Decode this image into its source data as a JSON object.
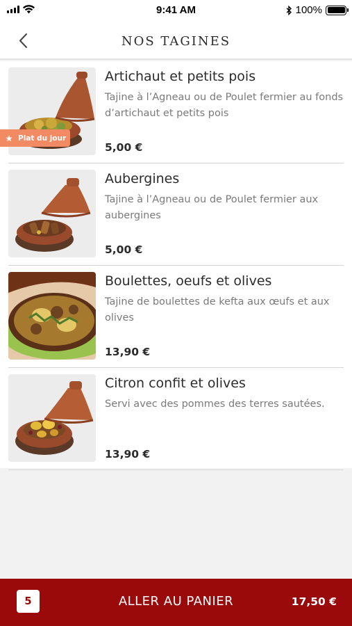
{
  "status_bar": {
    "time": "9:41 AM",
    "battery": "100%",
    "icons": [
      "signal-icon",
      "wifi-icon",
      "bluetooth-icon",
      "battery-icon"
    ]
  },
  "header": {
    "title": "NOS TAGINES",
    "back_icon": "chevron-left-icon"
  },
  "items": [
    {
      "name": "Artichaut et petits pois",
      "description": "Tajine à l’Agneau ou de Poulet fermier au fonds d’artichaut et petits pois",
      "price": "5,00 €",
      "badge": "Plat du jour",
      "badge_icon": "star-icon"
    },
    {
      "name": "Aubergines",
      "description": "Tajine à l’Agneau ou de Poulet fermier aux aubergines",
      "price": "5,00 €"
    },
    {
      "name": "Boulettes, oeufs et olives",
      "description": "Tajine de boulettes de kefta aux œufs et aux olives",
      "price": "13,90 €"
    },
    {
      "name": "Citron confit et olives",
      "description": "Servi avec des pommes des terres sautées.",
      "price": "13,90 €"
    }
  ],
  "cart": {
    "count": "5",
    "label": "ALLER AU PANIER",
    "total": "17,50 €"
  },
  "colors": {
    "accent": "#9a0a0a",
    "badge": "#f28a63",
    "text": "#2b2b2b",
    "muted": "#7a7a7a"
  }
}
